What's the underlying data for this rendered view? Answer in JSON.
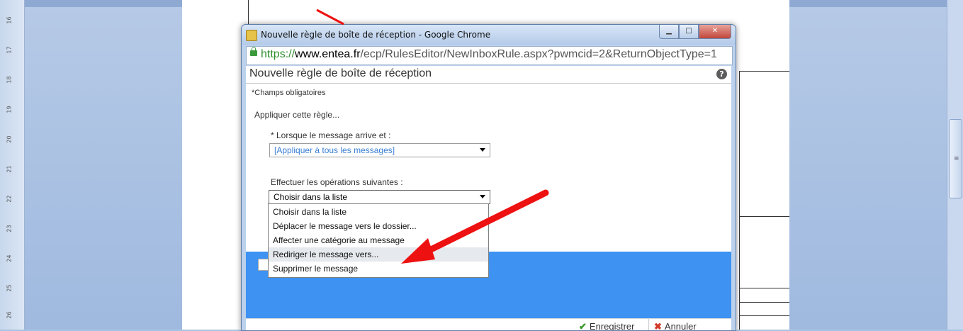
{
  "window": {
    "title": "Nouvelle règle de boîte de réception - Google Chrome",
    "buttons": [
      "minimize",
      "maximize",
      "close"
    ]
  },
  "address": {
    "scheme": "https://",
    "host": "www.entea.fr",
    "path": "/ecp/RulesEditor/NewInboxRule.aspx?pwmcid=2&ReturnObjectType=1"
  },
  "form": {
    "title": "Nouvelle règle de boîte de réception",
    "help": "?",
    "required_note": "*Champs obligatoires",
    "apply_label": "Appliquer cette règle...",
    "condition_label": "* Lorsque le message arrive et :",
    "condition_value": "[Appliquer à tous les messages]",
    "action_label": "Effectuer les opérations suivantes :",
    "action_value": "Choisir dans la liste"
  },
  "dropdown": {
    "items": [
      "Choisir dans la liste",
      "Déplacer le message vers le dossier...",
      "Affecter une catégorie au message",
      "Rediriger le message vers...",
      "Supprimer le message"
    ],
    "highlighted_index": 3
  },
  "footer": {
    "save": "Enregistrer",
    "cancel": "Annuler"
  },
  "colors": {
    "panel_blue": "#3d92f2",
    "arrow_red": "#ee1111",
    "placeholder_blue": "#3a7fd4"
  },
  "ruler": {
    "markers": [
      "16",
      "17",
      "18",
      "19",
      "20",
      "21",
      "22",
      "23",
      "24",
      "25",
      "26"
    ]
  }
}
